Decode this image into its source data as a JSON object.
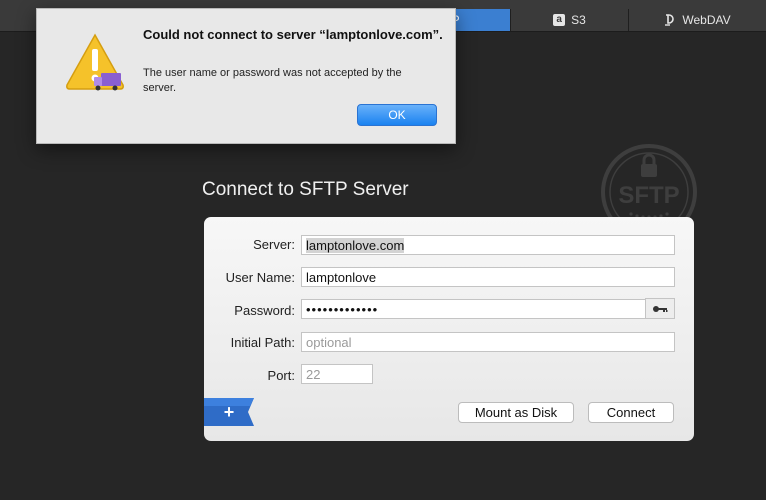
{
  "tabs": [
    {
      "label": "TP",
      "icon": "sftp-tab"
    },
    {
      "label": "S3",
      "icon": "s3-icon"
    },
    {
      "label": "WebDAV",
      "icon": "webdav-icon"
    }
  ],
  "alert": {
    "title": "Could not connect to server “lamptonlove.com”.",
    "message": "The user name or password was not accepted by the server.",
    "ok_label": "OK",
    "icon": "warning-icon"
  },
  "badge": {
    "text": "SFTP",
    "icon": "lock-icon"
  },
  "form": {
    "title": "Connect to SFTP Server",
    "server_label": "Server:",
    "server_value": "lamptonlove.com",
    "username_label": "User Name:",
    "username_value": "lamptonlove",
    "password_label": "Password:",
    "password_value": "•••••••••••••",
    "initial_path_label": "Initial Path:",
    "initial_path_placeholder": "optional",
    "port_label": "Port:",
    "port_placeholder": "22",
    "mount_label": "Mount as Disk",
    "connect_label": "Connect",
    "add_label": "+"
  },
  "colors": {
    "background": "#262626",
    "accent": "#3b7fd1",
    "ok_button": "#1a82f0",
    "ribbon": "#2f6cc7"
  }
}
